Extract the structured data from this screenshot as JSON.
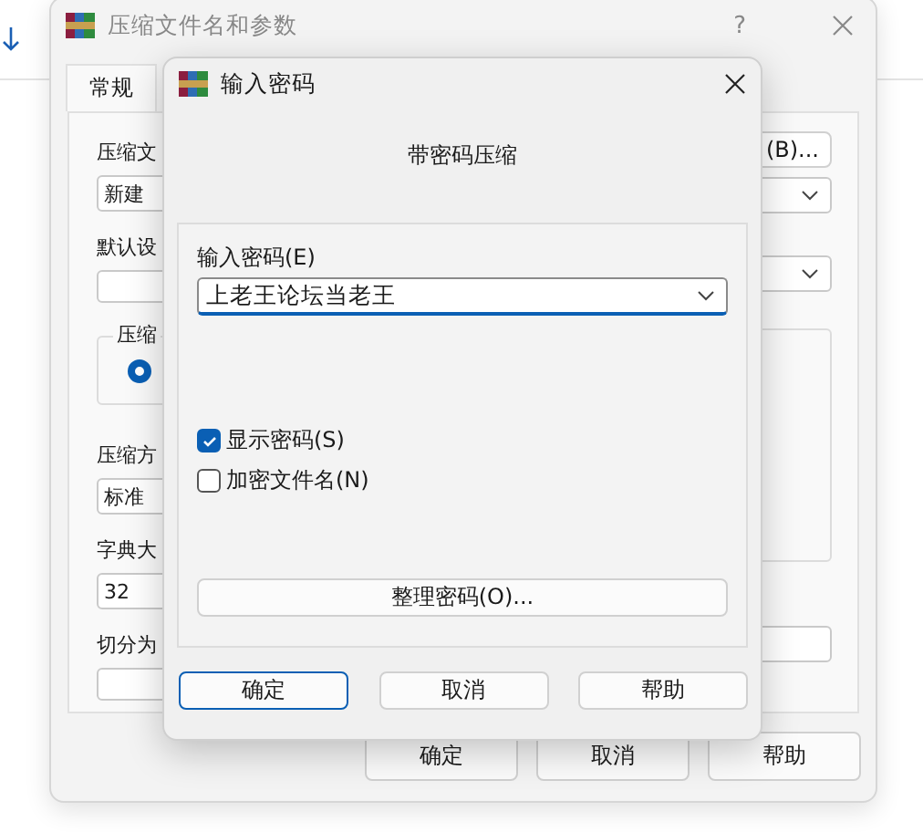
{
  "back_window": {
    "title": "压缩文件名和参数",
    "help_button": "?",
    "tabs": [
      {
        "label": "常规",
        "selected": true
      }
    ],
    "left_items": [
      {
        "kind": "label",
        "text": "压缩文"
      },
      {
        "kind": "field",
        "value": "新建"
      },
      {
        "kind": "label",
        "text": "默认设"
      },
      {
        "kind": "field"
      },
      {
        "kind": "group",
        "legend": "压缩",
        "radio": {
          "selected": true
        }
      },
      {
        "kind": "label",
        "text": "压缩方"
      },
      {
        "kind": "field",
        "value": "标准"
      },
      {
        "kind": "label",
        "text": "字典大"
      },
      {
        "kind": "field",
        "value": "32"
      },
      {
        "kind": "label",
        "text": "切分为"
      },
      {
        "kind": "field"
      }
    ],
    "browse_button": "(B)...",
    "buttons": [
      "确定",
      "取消",
      "帮助"
    ]
  },
  "dialog": {
    "title": "输入密码",
    "heading": "带密码压缩",
    "password_label": "输入密码(E)",
    "password_value": "上老王论坛当老王",
    "checkboxes": [
      {
        "label": "显示密码(S)",
        "checked": true
      },
      {
        "label": "加密文件名(N)",
        "checked": false
      }
    ],
    "organize_button": "整理密码(O)...",
    "buttons": [
      {
        "label": "确定",
        "default": true
      },
      {
        "label": "取消",
        "default": false
      },
      {
        "label": "帮助",
        "default": false
      }
    ]
  }
}
